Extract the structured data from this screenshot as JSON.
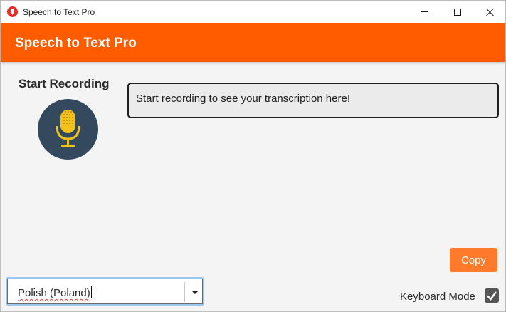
{
  "window": {
    "title": "Speech to Text Pro",
    "controls": [
      "minimize-icon",
      "maximize-icon",
      "close-icon"
    ]
  },
  "header": {
    "title": "Speech to Text Pro",
    "color": "#ff5c00"
  },
  "recording": {
    "label": "Start Recording",
    "icon": "microphone-icon"
  },
  "transcript": {
    "placeholder": "Start recording to see your transcription here!"
  },
  "actions": {
    "copy_label": "Copy"
  },
  "language": {
    "selected": "Polish (Poland)"
  },
  "keyboard_mode": {
    "label": "Keyboard Mode",
    "checked": true
  }
}
